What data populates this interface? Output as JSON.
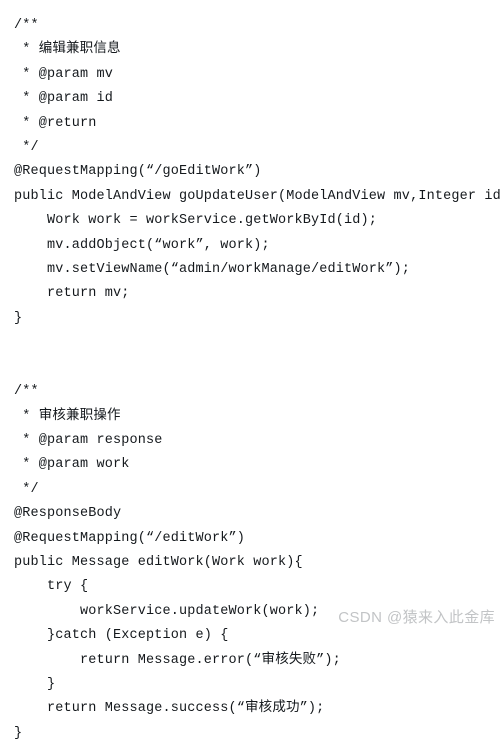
{
  "figure": {
    "kind": "code-snippet-screenshot",
    "language": "Java",
    "background_color": "#ffffff",
    "text_color": "#14181c"
  },
  "code": {
    "lines": [
      "/**",
      " * 编辑兼职信息",
      " * @param mv",
      " * @param id",
      " * @return",
      " */",
      "@RequestMapping(“/goEditWork”)",
      "public ModelAndView goUpdateUser(ModelAndView mv,Integer id){",
      "    Work work = workService.getWorkById(id);",
      "    mv.addObject(“work”, work);",
      "    mv.setViewName(“admin/workManage/editWork”);",
      "    return mv;",
      "}",
      "",
      "",
      "/**",
      " * 审核兼职操作",
      " * @param response",
      " * @param work",
      " */",
      "@ResponseBody",
      "@RequestMapping(“/editWork”)",
      "public Message editWork(Work work){",
      "    try {",
      "        workService.updateWork(work);",
      "    }catch (Exception e) {",
      "        return Message.error(“审核失败”);",
      "    }",
      "    return Message.success(“审核成功”);",
      "}"
    ]
  },
  "watermark": {
    "text": "CSDN @猿来入此金库",
    "color": "#c2c4c6"
  }
}
